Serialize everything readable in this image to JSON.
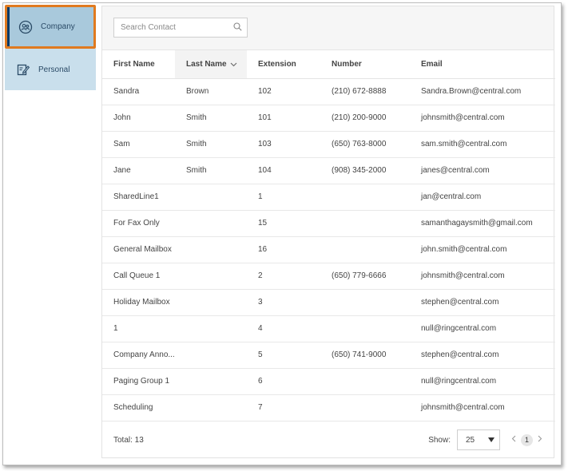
{
  "sidebar": {
    "items": [
      {
        "label": "Company",
        "icon": "company-icon",
        "selected": true
      },
      {
        "label": "Personal",
        "icon": "edit-contact-icon",
        "selected": false
      }
    ]
  },
  "search": {
    "placeholder": "Search Contact",
    "value": ""
  },
  "table": {
    "columns": [
      "First Name",
      "Last Name",
      "Extension",
      "Number",
      "Email"
    ],
    "sorted_column": "Last Name",
    "rows": [
      [
        "Sandra",
        "Brown",
        "102",
        "(210) 672-8888",
        "Sandra.Brown@central.com"
      ],
      [
        "John",
        "Smith",
        "101",
        "(210) 200-9000",
        "johnsmith@central.com"
      ],
      [
        "Sam",
        "Smith",
        "103",
        "(650) 763-8000",
        "sam.smith@central.com"
      ],
      [
        "Jane",
        "Smith",
        "104",
        "(908) 345-2000",
        "janes@central.com"
      ],
      [
        "SharedLine1",
        "",
        "1",
        "",
        "jan@central.com"
      ],
      [
        "For Fax Only",
        "",
        "15",
        "",
        "samanthagaysmith@gmail.com"
      ],
      [
        "General Mailbox",
        "",
        "16",
        "",
        "john.smith@central.com"
      ],
      [
        "Call Queue 1",
        "",
        "2",
        "(650) 779-6666",
        "johnsmith@central.com"
      ],
      [
        "Holiday Mailbox",
        "",
        "3",
        "",
        "stephen@central.com"
      ],
      [
        "1",
        "",
        "4",
        "",
        "null@ringcentral.com"
      ],
      [
        "Company Anno...",
        "",
        "5",
        "(650) 741-9000",
        "stephen@central.com"
      ],
      [
        "Paging Group 1",
        "",
        "6",
        "",
        "null@ringcentral.com"
      ],
      [
        "Scheduling",
        "",
        "7",
        "",
        "johnsmith@central.com"
      ]
    ]
  },
  "footer": {
    "total": "Total: 13",
    "show_label": "Show:",
    "page_size": "25",
    "current_page": "1"
  },
  "colors": {
    "selected_bg": "#a9c9dc",
    "item_bg": "#c9dfec",
    "highlight_border": "#e07a1f",
    "accent": "#0b3a66"
  }
}
